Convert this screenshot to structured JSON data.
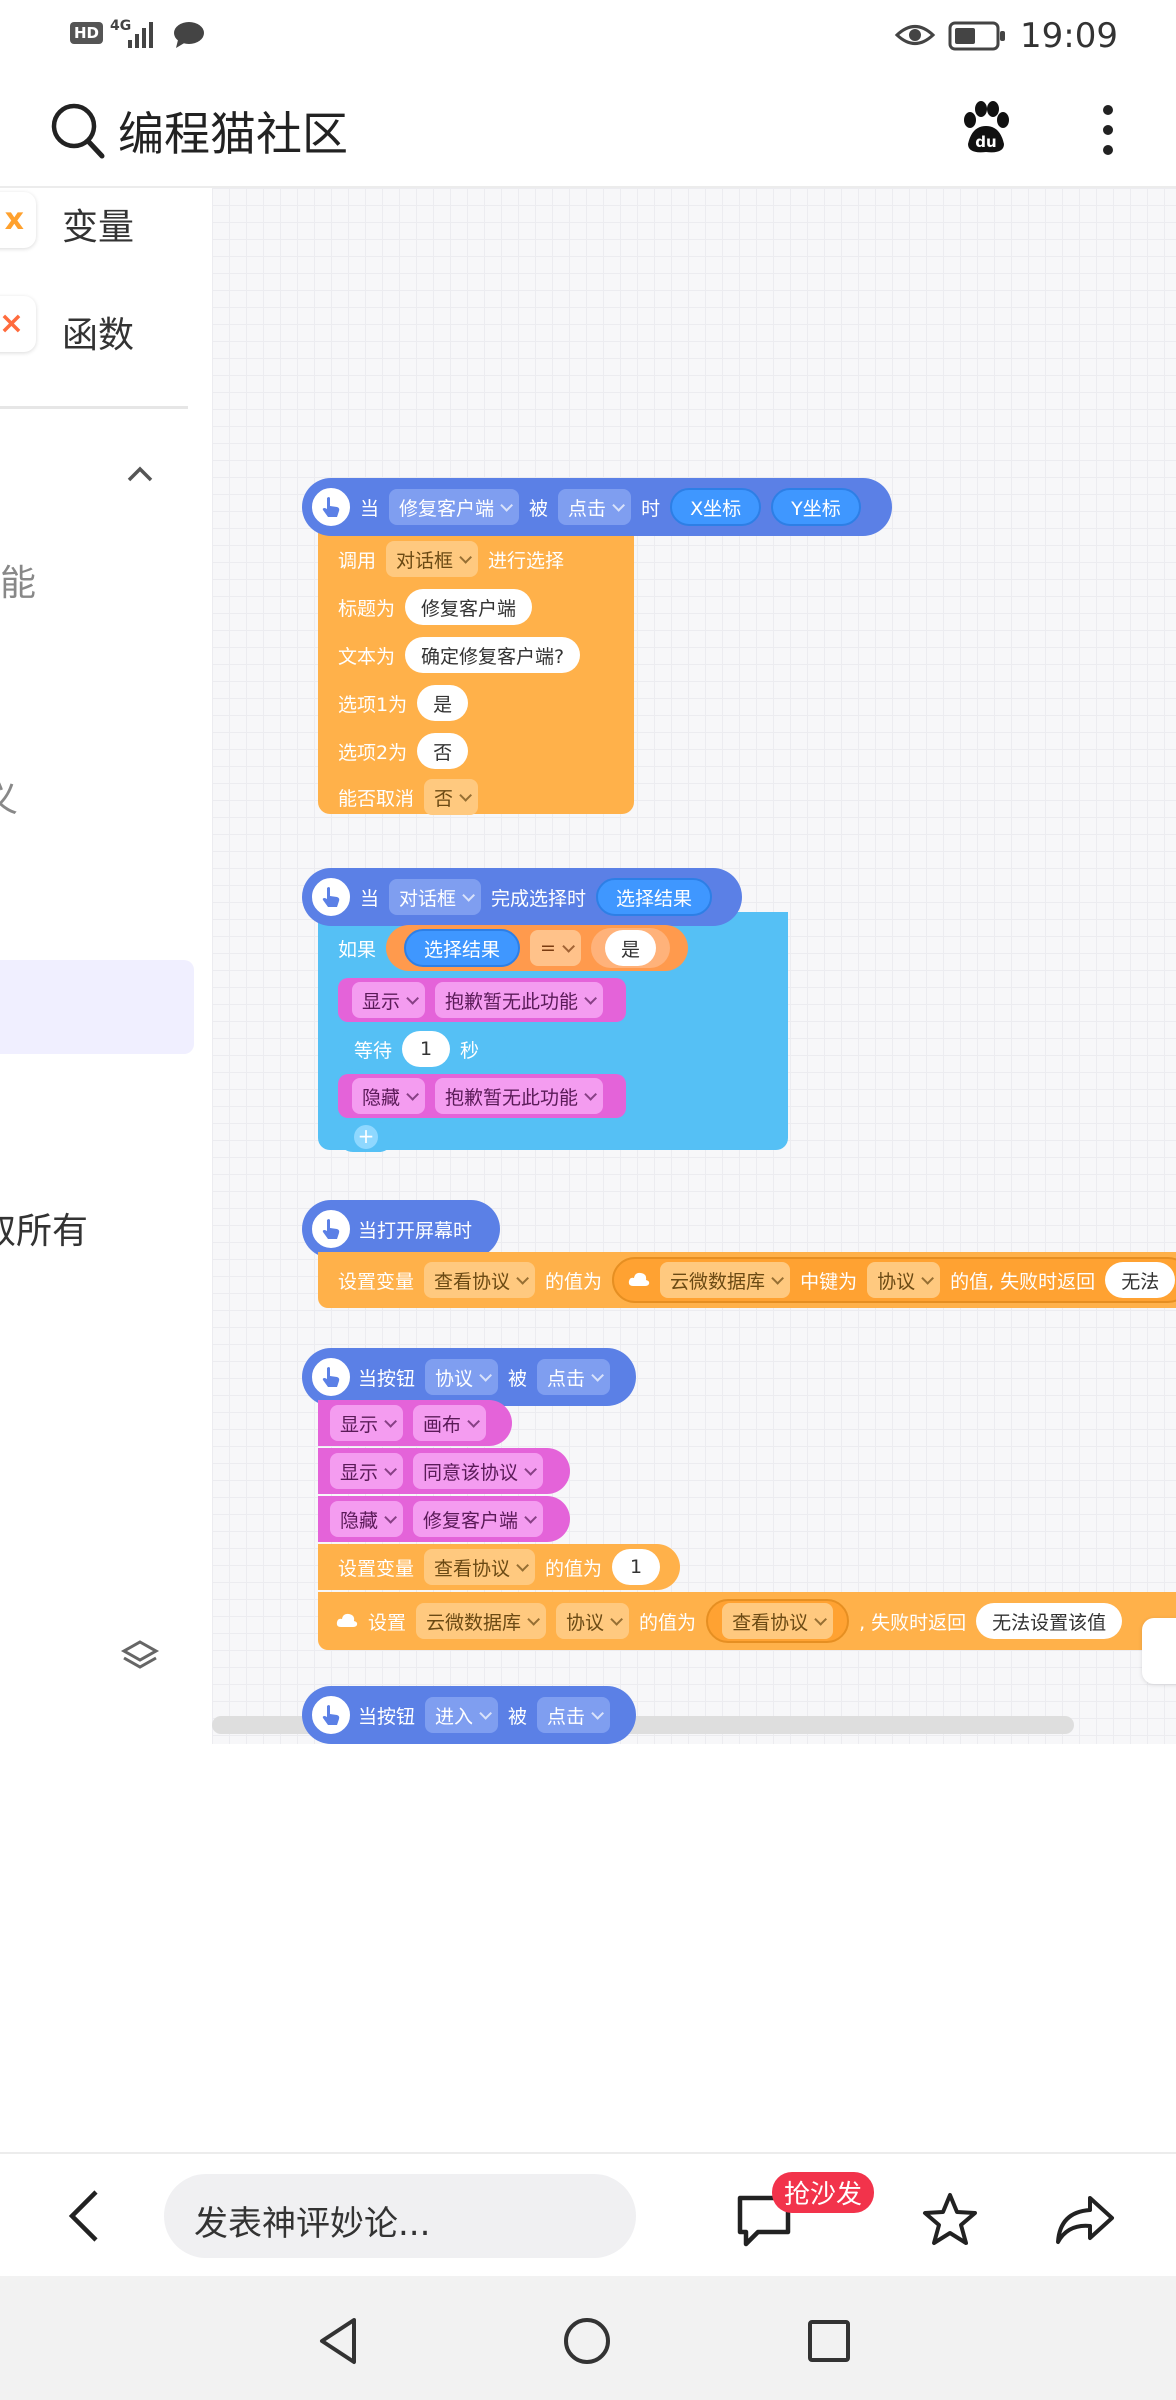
{
  "status": {
    "hd": "HD",
    "network": "4G",
    "time": "19:09"
  },
  "appbar": {
    "title": "编程猫社区"
  },
  "sidebar": {
    "items": [
      {
        "label": "变量"
      },
      {
        "label": "函数"
      }
    ],
    "partial_labels": [
      "功能",
      "义",
      "取所有"
    ]
  },
  "blocks": {
    "b1": {
      "when": "当",
      "target": "修复客户端",
      "bei": "被",
      "event": "点击",
      "shi": "时",
      "x": "X坐标",
      "y": "Y坐标",
      "call": "调用",
      "dialog": "对话框",
      "choose": "进行选择",
      "title_label": "标题为",
      "title_val": "修复客户端",
      "text_label": "文本为",
      "text_val": "确定修复客户端?",
      "opt1_label": "选项1为",
      "opt1_val": "是",
      "opt2_label": "选项2为",
      "opt2_val": "否",
      "cancel_label": "能否取消",
      "cancel_val": "否"
    },
    "b2": {
      "when": "当",
      "dialog": "对话框",
      "done": "完成选择时",
      "result": "选择结果",
      "if": "如果",
      "cmp_left": "选择结果",
      "op": "=",
      "cmp_right": "是",
      "show": "显示",
      "msg": "抱歉暂无此功能",
      "wait": "等待",
      "secs": "1",
      "sec_unit": "秒",
      "hide": "隐藏",
      "plus": "+"
    },
    "b3": {
      "hat": "当打开屏幕时",
      "set_var": "设置变量",
      "var": "查看协议",
      "value_of": "的值为",
      "db": "云微数据库",
      "key_label": "中键为",
      "key": "协议",
      "fail": "的值, 失败时返回",
      "fail_val": "无法"
    },
    "b4": {
      "hat": "当按钮",
      "btn": "协议",
      "bei": "被",
      "event": "点击",
      "show": "显示",
      "canvas": "画布",
      "agree": "同意该协议",
      "hide": "隐藏",
      "repair": "修复客户端",
      "set_var": "设置变量",
      "var": "查看协议",
      "value_of": "的值为",
      "num": "1",
      "cloud_set": "设置",
      "db": "云微数据库",
      "key": "协议",
      "val_label": "的值为",
      "val": "查看协议",
      "fail": ", 失败时返回",
      "fail_val": "无法设置该值"
    },
    "b5": {
      "hat": "当按钮",
      "btn": "进入",
      "bei": "被",
      "event": "点击"
    }
  },
  "bottom": {
    "comment_placeholder": "发表神评妙论...",
    "badge": "抢沙发"
  }
}
